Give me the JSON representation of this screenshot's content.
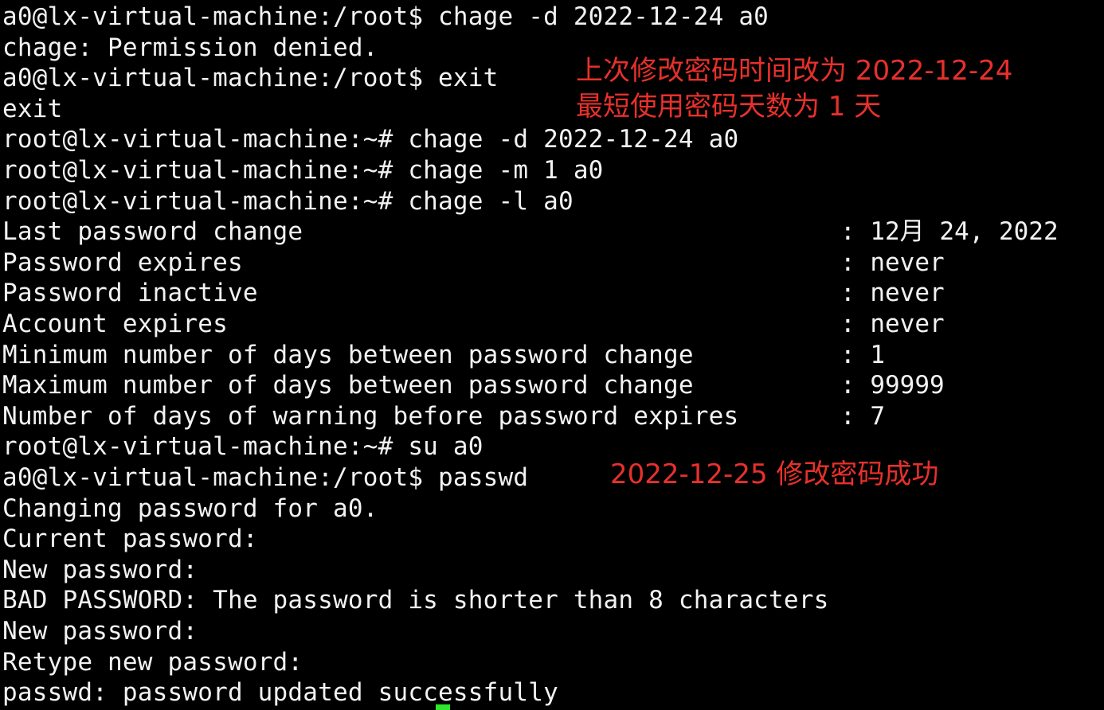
{
  "terminal": {
    "lines": [
      "a0@lx-virtual-machine:/root$ chage -d 2022-12-24 a0",
      "chage: Permission denied.",
      "a0@lx-virtual-machine:/root$ exit",
      "exit",
      "root@lx-virtual-machine:~# chage -d 2022-12-24 a0",
      "root@lx-virtual-machine:~# chage -m 1 a0",
      "root@lx-virtual-machine:~# chage -l a0",
      "Last password change",
      "Password expires",
      "Password inactive",
      "Account expires",
      "Minimum number of days between password change",
      "Maximum number of days between password change",
      "Number of days of warning before password expires",
      "root@lx-virtual-machine:~# su a0",
      "a0@lx-virtual-machine:/root$ passwd",
      "Changing password for a0.",
      "Current password:",
      "New password:",
      "BAD PASSWORD: The password is shorter than 8 characters",
      "New password:",
      "Retype new password:",
      "passwd: password updated successfully"
    ],
    "values": [
      ": 12月 24, 2022",
      ": never",
      ": never",
      ": never",
      ": 1",
      ": 99999",
      ": 7"
    ]
  },
  "annotations": {
    "line1": "上次修改密码时间改为 2022-12-24",
    "line2": "最短使用密码天数为 1 天",
    "line3": "2022-12-25 修改密码成功"
  },
  "colors": {
    "background": "#000000",
    "text": "#f2f2f2",
    "annotation": "#e8302b",
    "cursor": "#2ee82e"
  }
}
